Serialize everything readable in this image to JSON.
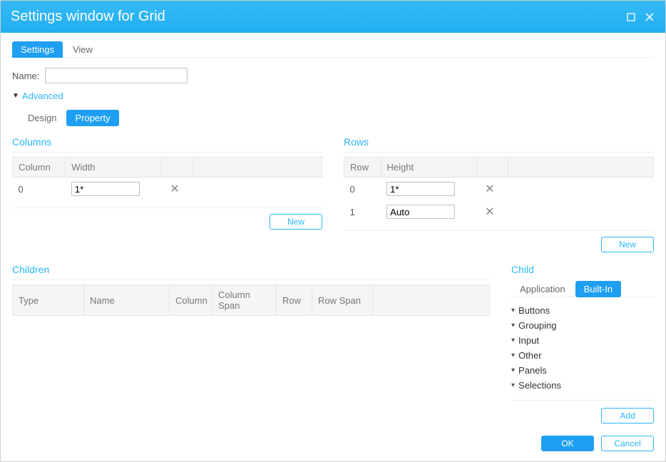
{
  "window": {
    "title": "Settings window for Grid"
  },
  "top_tabs": {
    "settings": "Settings",
    "view": "View",
    "active": "settings"
  },
  "name_field": {
    "label": "Name:",
    "value": ""
  },
  "advanced": {
    "label": "Advanced"
  },
  "sub_tabs": {
    "design": "Design",
    "property": "Property",
    "active": "property"
  },
  "columns": {
    "title": "Columns",
    "headers": {
      "index": "Column",
      "width": "Width"
    },
    "rows": [
      {
        "index": "0",
        "width": "1*"
      }
    ],
    "new_label": "New"
  },
  "rows": {
    "title": "Rows",
    "headers": {
      "index": "Row",
      "height": "Height"
    },
    "rows": [
      {
        "index": "0",
        "height": "1*"
      },
      {
        "index": "1",
        "height": "Auto"
      }
    ],
    "new_label": "New"
  },
  "children": {
    "title": "Children",
    "headers": {
      "type": "Type",
      "name": "Name",
      "column": "Column",
      "colspan": "Column Span",
      "row": "Row",
      "rowspan": "Row Span"
    }
  },
  "child": {
    "title": "Child",
    "tabs": {
      "application": "Application",
      "builtin": "Built-In",
      "active": "builtin"
    },
    "categories": [
      "Buttons",
      "Grouping",
      "Input",
      "Other",
      "Panels",
      "Selections"
    ],
    "add_label": "Add"
  },
  "dialog": {
    "ok": "OK",
    "cancel": "Cancel"
  }
}
